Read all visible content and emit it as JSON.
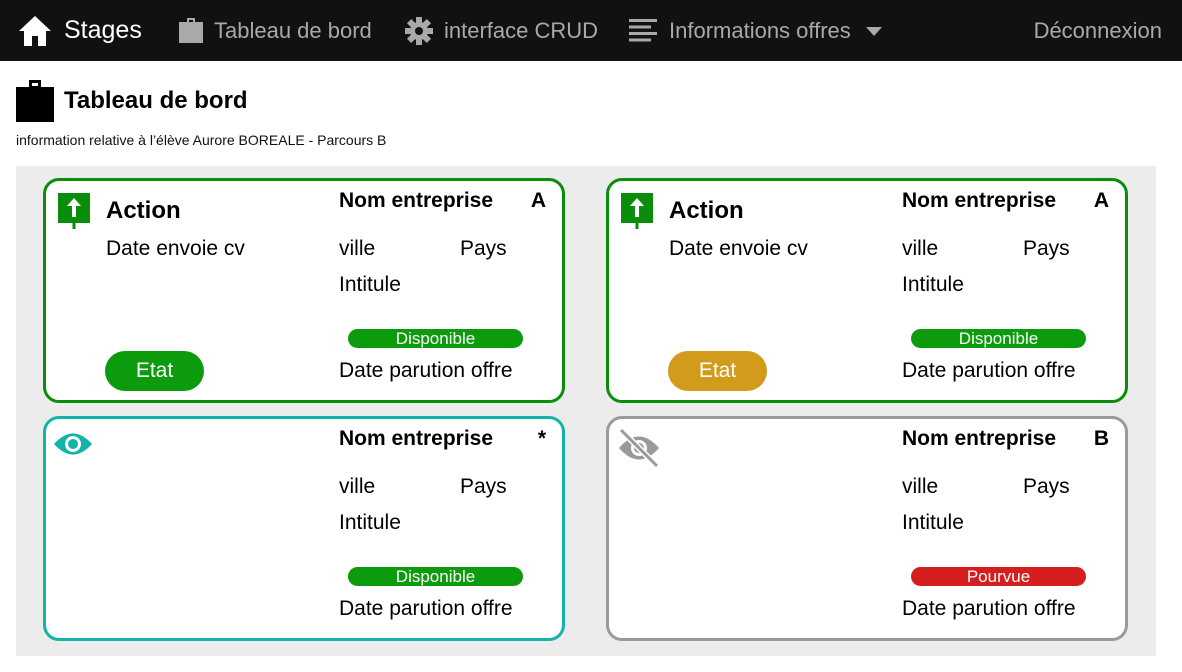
{
  "navbar": {
    "brand": "Stages",
    "dashboard": "Tableau de bord",
    "crud": "interface CRUD",
    "offres": "Informations offres",
    "logout": "Déconnexion"
  },
  "header": {
    "title": "Tableau de bord",
    "subtitle": "information relative à l’élève Aurore BOREALE - Parcours B"
  },
  "colors": {
    "green": "#0c9b0c",
    "teal": "#12b3a8",
    "grey": "#9a9a9a",
    "orange": "#d29b1b",
    "red": "#d51f1f"
  },
  "cards": [
    {
      "icon": "upload-arrow-icon",
      "action": "Action",
      "date_cv": "Date envoie cv",
      "company": "Nom entreprise",
      "grade": "A",
      "ville": "ville",
      "pays": "Pays",
      "intitule": "Intitule",
      "status": "Disponible",
      "parution": "Date parution offre",
      "etat": "Etat"
    },
    {
      "icon": "upload-arrow-icon",
      "action": "Action",
      "date_cv": "Date envoie cv",
      "company": "Nom entreprise",
      "grade": "A",
      "ville": "ville",
      "pays": "Pays",
      "intitule": "Intitule",
      "status": "Disponible",
      "parution": "Date parution offre",
      "etat": "Etat"
    },
    {
      "icon": "eye-icon",
      "company": "Nom entreprise",
      "grade": "*",
      "ville": "ville",
      "pays": "Pays",
      "intitule": "Intitule",
      "status": "Disponible",
      "parution": "Date parution offre"
    },
    {
      "icon": "eye-off-icon",
      "company": "Nom entreprise",
      "grade": "B",
      "ville": "ville",
      "pays": "Pays",
      "intitule": "Intitule",
      "status": "Pourvue",
      "parution": "Date parution offre"
    }
  ]
}
